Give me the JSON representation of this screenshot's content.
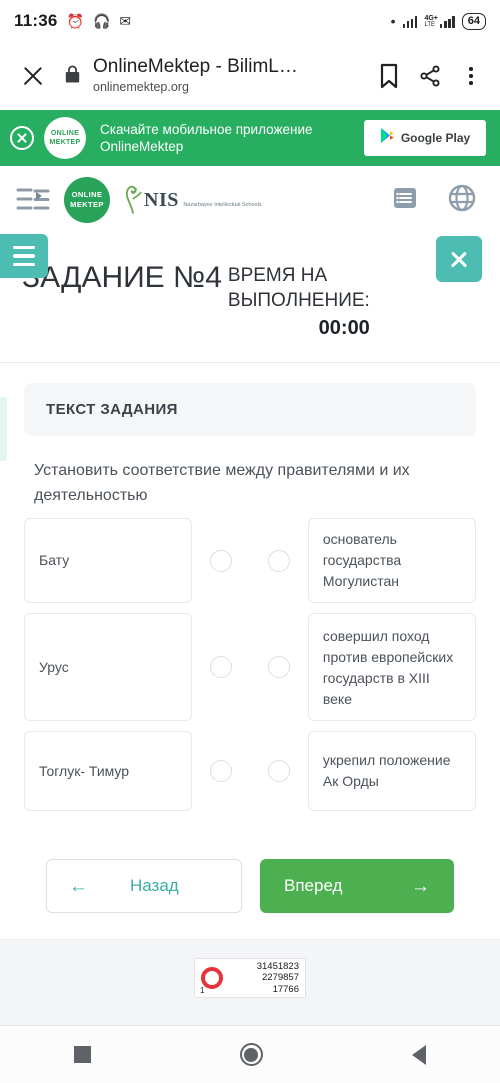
{
  "status_bar": {
    "time": "11:36",
    "alarm_icon": "alarm-icon",
    "headphones_icon": "headphones-icon",
    "whatsapp_icon": "whatsapp-icon",
    "bluetooth_icon": "bluetooth-icon",
    "network_type": "4G+",
    "network_sub": "LTE",
    "battery": "64"
  },
  "browser": {
    "close_label": "close-tab",
    "page_title": "OnlineMektep - BilimL…",
    "url": "onlinemektep.org",
    "bookmark_icon": "bookmark-icon",
    "share_icon": "share-icon",
    "menu_icon": "overflow-menu-icon"
  },
  "app_banner": {
    "close_icon": "close-circle-icon",
    "logo_line1": "ONLINE",
    "logo_line2": "MEKTEP",
    "text_line1": "Скачайте мобильное приложение",
    "text_line2": "OnlineMektep",
    "store_label": "Google Play",
    "background": "#27ae60"
  },
  "site_header": {
    "toggle_icon": "sidebar-toggle-icon",
    "logo_om_line1": "ONLINE",
    "logo_om_line2": "MEKTEP",
    "logo_nis_text": "NIS",
    "logo_nis_sub": "Nazarbayev Intellectual Schools",
    "list_icon": "list-view-icon",
    "language_icon": "globe-icon"
  },
  "task_band": {
    "menu_icon": "hamburger-menu-icon",
    "close_icon": "close-task-icon",
    "title": "ЗАДАНИЕ №4",
    "timer_label_line1": "ВРЕМЯ НА",
    "timer_label_line2": "ВЫПОЛНЕНИЕ:",
    "timer_value": "00:00",
    "accent_color": "#4dbdb4"
  },
  "task": {
    "section_header": "ТЕКСТ ЗАДАНИЯ",
    "description": "Установить соответствие между правителями и их деятельностью",
    "rows": [
      {
        "left": "Бату",
        "right": "основатель государства Могулистан"
      },
      {
        "left": "Урус",
        "right": "совершил поход против европейских государств в XIII веке"
      },
      {
        "left": "Тоглук- Тимур",
        "right": "укрепил положение Ак Орды"
      }
    ]
  },
  "nav": {
    "back_label": "Назад",
    "back_arrow": "←",
    "next_label": "Вперед",
    "next_arrow": "→",
    "next_color": "#4cb050",
    "back_color": "#3aaea4"
  },
  "footer_counter": {
    "rank": "1",
    "line1": "31451823",
    "line2": "2279857",
    "line3": "17766",
    "ring_color": "#e8323c"
  },
  "android_nav": {
    "recents_icon": "recents-square-icon",
    "home_icon": "home-circle-icon",
    "back_icon": "back-triangle-icon"
  }
}
